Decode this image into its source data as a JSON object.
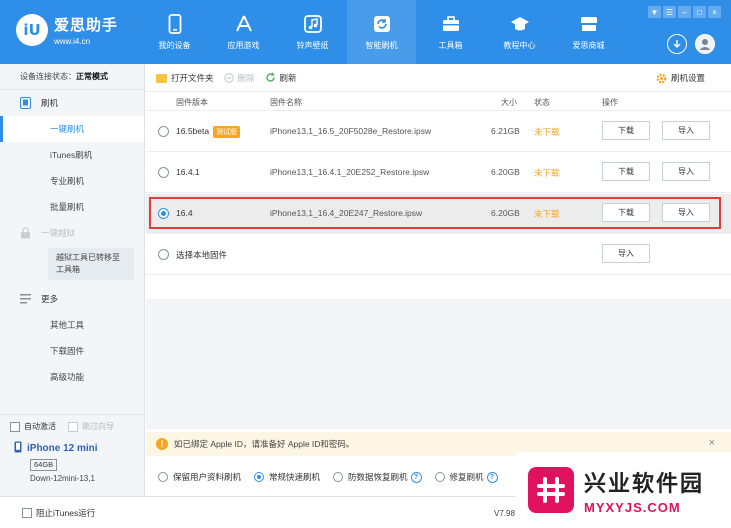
{
  "app": {
    "logo_mark": "iU",
    "logo_name": "爱思助手",
    "logo_url": "www.i4.cn"
  },
  "nav": [
    {
      "label": "我的设备",
      "icon": "phone-icon"
    },
    {
      "label": "应用游戏",
      "icon": "apps-icon"
    },
    {
      "label": "铃声壁纸",
      "icon": "music-icon"
    },
    {
      "label": "智能刷机",
      "icon": "refresh-icon",
      "active": true
    },
    {
      "label": "工具箱",
      "icon": "toolbox-icon"
    },
    {
      "label": "教程中心",
      "icon": "graduation-cap-icon"
    },
    {
      "label": "爱思商城",
      "icon": "store-icon"
    }
  ],
  "window_controls": [
    "▼",
    "☰",
    "–",
    "□",
    "×"
  ],
  "sidebar": {
    "status_label": "设备连接状态：",
    "status_value": "正常模式",
    "flash_group": "刷机",
    "flash_items": [
      "一键刷机",
      "iTunes刷机",
      "专业刷机",
      "批量刷机"
    ],
    "jailbreak_group": "一键越狱",
    "jailbreak_note": "越狱工具已转移至工具箱",
    "more_group": "更多",
    "more_items": [
      "其他工具",
      "下载固件",
      "高级功能"
    ],
    "auto_activate": "自动激活",
    "skip_guide": "跳过向导",
    "device_name": "iPhone 12 mini",
    "device_storage": "64GB",
    "device_model": "Down-12mini-13,1"
  },
  "toolbar": {
    "open_folder": "打开文件夹",
    "delete": "删除",
    "refresh": "刷新",
    "settings": "刷机设置"
  },
  "table": {
    "headers": {
      "version": "固件版本",
      "name": "固件名称",
      "size": "大小",
      "status": "状态",
      "action": "操作"
    },
    "rows": [
      {
        "version": "16.5beta",
        "badge": "测试版",
        "name": "iPhone13,1_16.5_20F5028e_Restore.ipsw",
        "size": "6.21GB",
        "status": "未下载",
        "download": "下载",
        "import": "导入",
        "selected": false
      },
      {
        "version": "16.4.1",
        "badge": "",
        "name": "iPhone13,1_16.4.1_20E252_Restore.ipsw",
        "size": "6.20GB",
        "status": "未下载",
        "download": "下载",
        "import": "导入",
        "selected": false
      },
      {
        "version": "16.4",
        "badge": "",
        "name": "iPhone13,1_16.4_20E247_Restore.ipsw",
        "size": "6.20GB",
        "status": "未下载",
        "download": "下载",
        "import": "导入",
        "selected": true
      }
    ],
    "local_label": "选择本地固件",
    "local_import": "导入"
  },
  "notice": {
    "text": "如已绑定 Apple ID，请准备好 Apple ID和密码。",
    "close": "×"
  },
  "modes": [
    {
      "label": "保留用户资料刷机",
      "selected": false,
      "help": false
    },
    {
      "label": "常规快速刷机",
      "selected": true,
      "help": false
    },
    {
      "label": "防数据恢复刷机",
      "selected": false,
      "help": true
    },
    {
      "label": "修复刷机",
      "selected": false,
      "help": true
    }
  ],
  "statusbar": {
    "block_itunes": "阻止iTunes运行",
    "version": "V7.98"
  },
  "watermark": {
    "cn": "兴业软件园",
    "en": "MYXYJS.COM"
  },
  "colors": {
    "brand": "#2f8fe8",
    "highlight_border": "#e03d3d",
    "status_orange": "#f5a623",
    "watermark_pink": "#e0115f"
  }
}
